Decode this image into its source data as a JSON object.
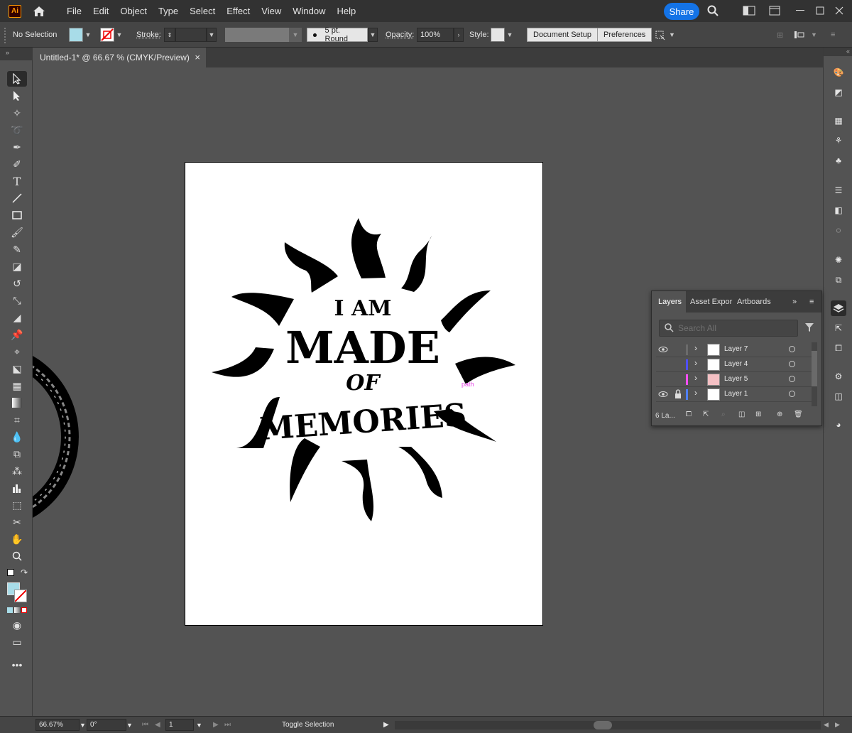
{
  "app": {
    "logo": "Ai",
    "menu": [
      "File",
      "Edit",
      "Object",
      "Type",
      "Select",
      "Effect",
      "View",
      "Window",
      "Help"
    ],
    "share": "Share"
  },
  "control": {
    "selection": "No Selection",
    "stroke_label": "Stroke:",
    "brush": "5 pt. Round",
    "opacity_label": "Opacity:",
    "opacity": "100%",
    "style_label": "Style:",
    "doc_setup": "Document Setup",
    "preferences": "Preferences",
    "fill_color": "#a8dce8"
  },
  "document": {
    "tab_title": "Untitled-1* @ 66.67 % (CMYK/Preview)"
  },
  "artwork": {
    "line1": "I AM",
    "line2": "MADE",
    "line3": "OF",
    "line4": "MEMORIES",
    "path_hint": "path"
  },
  "layers_panel": {
    "tabs": [
      "Layers",
      "Asset Expor",
      "Artboards"
    ],
    "search_placeholder": "Search All",
    "rows": [
      {
        "name": "Layer 7",
        "color": "#6b6b6b",
        "visible": true,
        "locked": false
      },
      {
        "name": "Layer 4",
        "color": "#4f4fff",
        "visible": false,
        "locked": false
      },
      {
        "name": "Layer 5",
        "color": "#ff4fff",
        "visible": false,
        "locked": false
      },
      {
        "name": "Layer 1",
        "color": "#4f80ff",
        "visible": true,
        "locked": true
      }
    ],
    "count": "6 La..."
  },
  "status": {
    "zoom": "66.67%",
    "rotation": "0°",
    "artboard": "1",
    "toggle": "Toggle Selection"
  }
}
